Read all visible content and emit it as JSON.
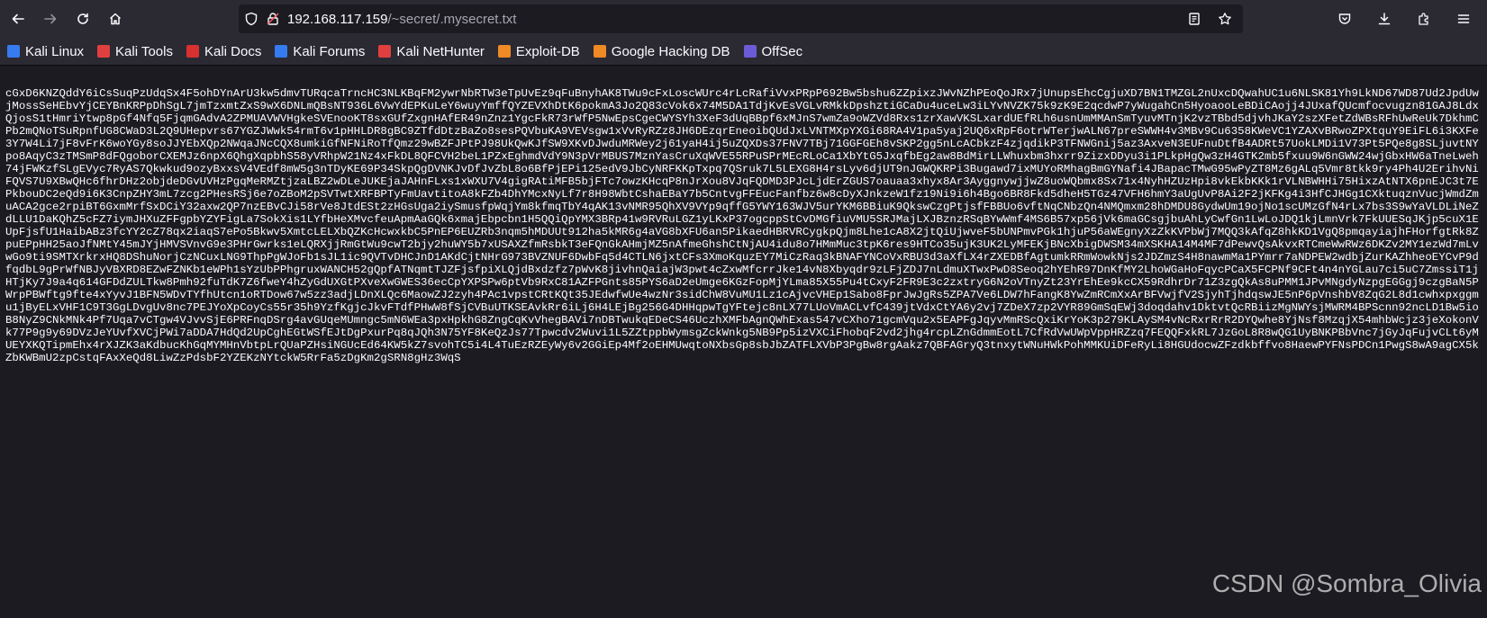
{
  "address_bar": {
    "host": "192.168.117.159",
    "path": "/~secret/.mysecret.txt"
  },
  "bookmarks": [
    {
      "label": "Kali Linux",
      "icon": "kali-dragon-icon",
      "color": "#367bf0"
    },
    {
      "label": "Kali Tools",
      "icon": "kali-tools-icon",
      "color": "#e03f3f"
    },
    {
      "label": "Kali Docs",
      "icon": "kali-docs-icon",
      "color": "#d93030"
    },
    {
      "label": "Kali Forums",
      "icon": "kali-forums-icon",
      "color": "#367bf0"
    },
    {
      "label": "Kali NetHunter",
      "icon": "nethunter-icon",
      "color": "#e03f3f"
    },
    {
      "label": "Exploit-DB",
      "icon": "exploit-db-icon",
      "color": "#f08a24"
    },
    {
      "label": "Google Hacking DB",
      "icon": "ghdb-icon",
      "color": "#f08a24"
    },
    {
      "label": "OffSec",
      "icon": "offsec-icon",
      "color": "#6b5bd6"
    }
  ],
  "file_content": "cGxD6KNZQddY6iCsSuqPzUdqSx4F5ohDYnArU3kw5dmvTURqcaTrncHC3NLKBqFM2ywrNbRTW3eTpUvEz9qFuBnyhAK8TWu9cFxLoscWUrc4rLcRafiVvxPRpP692Bw5bshu6ZZpixzJWvNZhPEoQoJRx7jUnupsEhcCgjuXD7BN1TMZGL2nUxcDQwahUC1u6NLSK81Yh9LkND67WD87Ud2JpdUwjMossSeHEbvYjCEYBnKRPpDhSgL7jmTzxmtZxS9wX6DNLmQBsNT936L6VwYdEPKuLeY6wuyYmffQYZEVXhDtK6pokmA3Jo2Q83cVok6x74M5DA1TdjKvEsVGLvRMkkDpshztiGCaDu4uceLw3iLYvNVZK75k9zK9E2qcdwP7yWugahCn5HyoaooLeBDiCAojj4JUxafQUcmfocvugzn81GAJ8LdxQjosS1tHmriYtwp8pGf4Nfq5FjqmGAdvA2ZPMUAVWVHgkeSVEnooKT8sxGUfZxgnHAfER49nZnz1YgcFkR73rWfP5NwEpsCgeCWYSYh3XeF3dUqBBpf6xMJnS7wmZa9oWZVd8Rxs1zrXawVKSLxardUEfRLh6usnUmMMAnSmTyuvMTnjK2vzTBbd5djvhJKaY2szXFetZdWBsRFhUwReUk7DkhmCPb2mQNoTSuRpnfUG8CWaD3L2Q9UHepvrs67YGZJWwk54rmT6v1pHHLDR8gBC9ZTfdDtzBaZo8sesPQVbuKA9VEVsgw1xVvRyRZz8JH6DEzqrEneoibQUdJxLVNTMXpYXGi68RA4V1pa5yaj2UQ6xRpF6otrWTerjwALN67preSWWH4v3MBv9Cu6358KWeVC1YZAXvBRwoZPXtquY9EiFL6i3KXFe3Y7W4Li7jF8vFrK6woYGy8soJJYEbXQp2NWqaJNcCQX8umkiGfNFNiRoTfQmz29wBZFJPtPJ98UkQwKJfSW9XKvDJwduMRWey2j61yaH4ij5uZQXDs37FNV7TBj71GGFGEh8vSKP2gg5nLcACbkzF4zjqdikP3TFNWGnij5az3AxveN3EUFnuDtfB4ADRt57UokLMDi1V73Pt5PQe8g8SLjuvtNYpo8AqyC3zTMSmP8dFQgoborCXEMJz6npX6QhgXqpbhS58yVRhpW21Nz4xFkDL8QFCVH2beL1PZxEghmdVdY9N3pVrMBUS7MznYasCruXqWVE55RPuSPrMEcRLoCa1XbYtG5JxqfbEg2aw8BdMirLLWhuxbm3hxrr9ZizxDDyu3i1PLkpHgQw3zH4GTK2mb5fxuu9W6nGWW24wjGbxHW6aTneLweh74jFWKzfSLgEVyc7RyAS7Qkwkud9ozyBxxsV4VEdf8mW5g3nTDyKE69P34SkpQgDVNKJvDfJvZbL8o6BfPjEPi125edV9JbCyNRFKKpTxpq7QSruk7L5LEXG8H4rsLyv6djUT9nJGWQKRPi3Bugawd7ixMUYoRMhagBmGYNafi4JBapacTMwG95wPyZT8Mz6gALq5Vmr8tkk9ry4Ph4U2ErihvNiFQVS7U9XBwQHc6fhrDHz2objdeDGvUVHzPgqMeRMZtjzaLBZ2wDLeJUKEjaJAHnFLxs1xWXU7V4gigRAtiMFB5bjFTc7owzKHcqP8nJrXou8VJqFQDMD3PJcLjdErZGUS7oauaa3xhyx8Ar3AyggnywjjwZ8uoWQbmx8Sx71x4NyhHZUzHpi8vkEkbKKk1rVLNBWHHi75HixzAtNTX6pnEJC3t7EPkbouDC2eQd9i6K3CnpZHY3mL7zcg2PHesRSj6e7oZBoM2pSVTwtXRFBPTyFmUavtitoA8kFZb4DhYMcxNyLf7r8H98WbtCshaEBaY7b5CntvgFFEucFanfbz6w8cDyXJnkzeW1fz19Ni9i6h4Bgo6BR8Fkd5dheH5TGz47VFH6hmY3aUgUvP8Ai2F2jKFKg4i3HfCJHGg1CXktuqznVucjWmdZmuACA2gce2rpiBT6GxmMrfSxDCiY32axw2QP7nzEBvCJi58rVe8JtdESt2zHGsUga2iySmusfpWqjYm8kfmqTbY4qAK13vNMR95QhXV9VYp9qffG5YWY163WJV5urYKM6BBiuK9QkswCzgPtjsfFBBUo6vftNqCNbzQn4NMQmxm28hDMDU8GydwUm19ojNo1scUMzGfN4rLx7bs3S9wYaVLDLiNeZdLLU1DaKQhZ5cFZ7iymJHXuZFFgpbYZYFigLa7SokXis1LYfbHeXMvcfeuApmAaGQk6xmajEbpcbn1H5QQiQpYMX3BRp41w9RVRuLGZ1yLKxP37ogcppStCvDMGfiuVMU5SRJMajLXJBznzRSqBYwWmf4MS6B57xp56jVk6maGCsgjbuAhLyCwfGn1LwLoJDQ1kjLmnVrk7FkUUESqJKjp5cuX1EUpFjsfU1HaibABz3fcYY2cZ78qx2iaqS7ePo5Bkwv5XmtcLELXbQZKcHcwxkbC5PnEP6EUZRb3nqm5hMDUUt912ha5kMR6g4aVG8bXFU6an5PikaedHBRVRCygkpQjm8Lhe1cA8X2jtQiUjwveF5bUNPmvPGk1hjuP56aWEgnyXzZkKVPbWj7MQQ3kAfqZ8hkKD1VgQ8pmqayiajhFHorfgtRk8ZpuEPpHH25aoJfNMtY45mJYjHMVSVnvG9e3PHrGwrks1eLQRXjjRmGtWu9cwT2bjy2huWY5b7xUSAXZfmRsbkT3eFQnGkAHmjMZ5nAfmeGhshCtNjAU4idu8o7HMmMuc3tpK6res9HTCo35ujK3UK2LyMFEKjBNcXbigDWSM34mXSKHA14M4MF7dPewvQsAkvxRTCmeWwRWz6DKZv2MY1ezWd7mLvwGo9ti9SMTXrkrxHQ8DShuNorjCzNCuxLNG9ThpPgWJoFb1sJL1ic9QVTvDHCJnD1AKdCjtNHrG973BVZNUF6DwbFq5d4CTLN6jxtCFs3XmoKquzEY7MiCzRaq3kBNAFYNCoVxRBU3d3aXfLX4rZXEDBfAgtumkRRmWowkNjs2JDZmzS4H8nawmMa1PYmrr7aNDPEW2wdbjZurKAZhheoEYCvP9dfqdbL9gPrWfNBJyVBXRD8EZwFZNKb1eWPh1sYzUbPPhgruxWANCH52gQpfATNqmtTJZFjsfpiXLQjdBxdzfz7pWvK8jivhnQaiajW3pwt4cZxwMfcrrJke14vN8Xbyqdr9zLFjZDJ7nLdmuXTwxPwD8Seoq2hYEhR97DnKfMY2LhoWGaHoFqycPCaX5FCPNf9CFt4n4nYGLau7ci5uC7ZmssiT1jHTjKy7J9a4q614GFDdZULTkw8Pmh92fuTdK7Z6fweY4hZyGdUXGtPXveXwGWES36ecCpYXPSPw6ptVb9RxC81AZFPGnts85PYS6aD2eUmge6KGzFopMjYLma85X55Pu4tCxyF2FR9E3c2zxtryG6N2oVTnyZt23YrEhEe9kcCX59RdhrDr71Z3zgQkAs8uPMM1JPvMNgdyNzpgEGGgj9czgBaN5PWrpPBWftg9fte4xYyvJ1BFN5WDvTYfhUtcn1oRTDow67w5zz3adjLDnXLQc6MaowZJ2zyh4PAc1vpstCRtKQt35JEdwfwUe4wzNr3sidChW8VuMU1Lz1cAjvcVHEp1Sabo8FprJwJgRs5ZPA7Ve6LDW7hFangK8YwZmRCmXxArBFVwjfV2SjyhTjhdqswJE5nP6pVnshbV8ZqG2L8d1cwhxpxggmu1jByELxVHF1C9T3GgLDvgUv8nc7PEJYoXpCoyCs55r35h9YzfKgjcJkvFTdfPHwW8fSjCVBuUTKSEAvkRr6iLj6H4LEjBg256G4DHHqpwTgYFtejc8nLX77LUoVmACLvfC439jtVdxCtYA6y2vj7ZDeX7zp2VYR89GmSqEWj3doqdahv1DktvtQcRBiizMgNWYsjMWRM4BPScnn92ncLD1Bw5ioB8NyZ9CNkMNk4Pf7Uqa7vCTgw4VJvvSjE6PRFnqDSrg4avGUqeMUmngc5mN6WEa3pxHpkhG8ZngCqKvVhegBAVi7nDBTwukqEDeCS46UczhXMFbAgnQWhExas547vCXho71gcmVqu2x5EAPFgJqyvMmRScQxiKrYoK3p279KLAySM4vNcRxrRrR2DYQwhe8YjNsf8MzqjX54mhbWcjz3jeXokonVk77P9g9y69DVzJeYUvfXVCjPWi7aDDA7HdQd2UpCghEGtWSfEJtDgPxurPq8qJQh3N75YF8KeQzJs77Tpwcdv2Wuvi1L5ZZtppbWymsgZckWnkg5NB9Pp5izVXCiFhobqF2vd2jhg4rcpLZnGdmmEotL7CfRdVwUWpVppHRZzq7FEQQFxkRL7JzGoL8R8wQG1UyBNKPBbVnc7jGyJqFujvCLt6yMUEYXKQTipmEhx4rXJZK3aKdbucKhGqMYMHnVbtpLrQUaPZHsiNGUcEd64KW5kZ7svohTC5i4L4TuEzRZEyWy6v2GGiEp4Mf2oEHMUwqtoNXbsGp8sbJbZATFLXVbP3PgBw8rgAakz7QBFAGryQ3tnxytWNuHWkPohMMKUiDFeRyLi8HGUdocwZFzdkbffvo8HaewPYFNsPDCn1PwgS8wA9agCX5kZbKWBmU2zpCstqFAxXeQd8LiwZzPdsbF2YZEKzNYtckW5RrFa5zDgKm2gSRN8gHz3WqS",
  "watermark": "CSDN @Sombra_Olivia"
}
